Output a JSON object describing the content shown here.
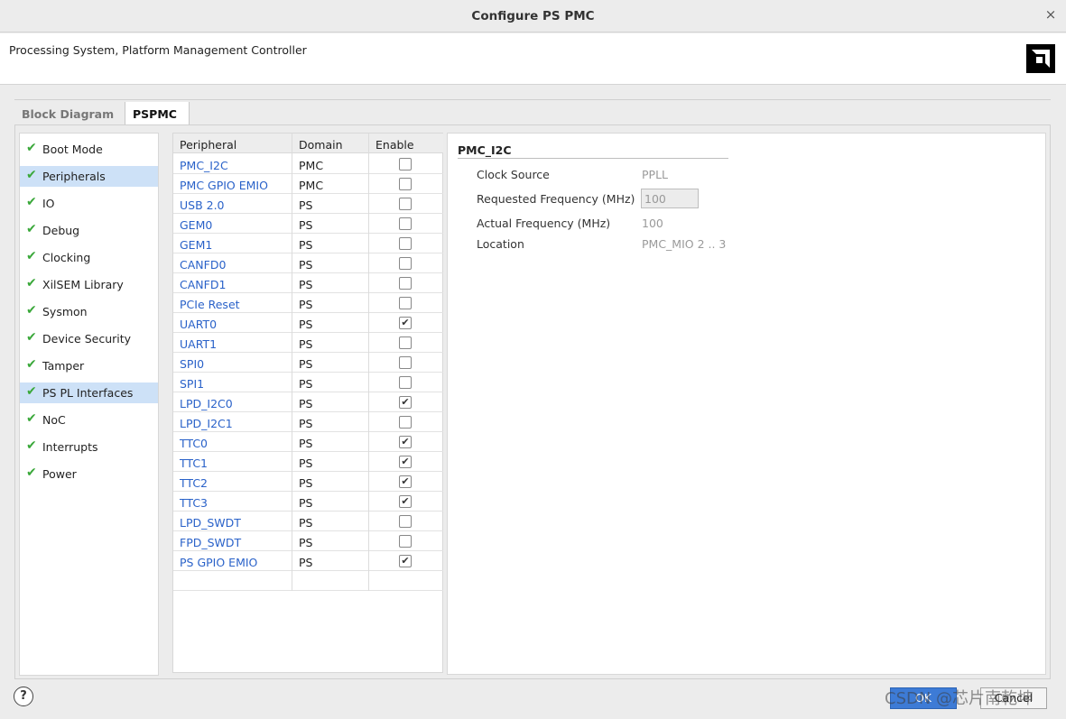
{
  "window": {
    "title": "Configure PS PMC",
    "close_glyph": "×"
  },
  "header": {
    "subtitle": "Processing System, Platform Management Controller",
    "logo": "amd-logo-icon"
  },
  "tabs": [
    {
      "label": "Block Diagram",
      "accesskey": "B",
      "selected": false
    },
    {
      "label": "PSPMC",
      "accesskey": "P",
      "selected": true
    }
  ],
  "sidebar": {
    "items": [
      {
        "label": "Boot Mode",
        "selected": false
      },
      {
        "label": "Peripherals",
        "selected": true
      },
      {
        "label": "IO",
        "selected": false
      },
      {
        "label": "Debug",
        "selected": false
      },
      {
        "label": "Clocking",
        "selected": false
      },
      {
        "label": "XilSEM Library",
        "selected": false
      },
      {
        "label": "Sysmon",
        "selected": false
      },
      {
        "label": "Device Security",
        "selected": false
      },
      {
        "label": "Tamper",
        "selected": false
      },
      {
        "label": "PS PL Interfaces",
        "selected": true
      },
      {
        "label": "NoC",
        "selected": false
      },
      {
        "label": "Interrupts",
        "selected": false
      },
      {
        "label": "Power",
        "selected": false
      }
    ],
    "check_glyph": "✔"
  },
  "table": {
    "columns": [
      "Peripheral",
      "Domain",
      "Enable"
    ],
    "rows": [
      {
        "peripheral": "PMC_I2C",
        "domain": "PMC",
        "enabled": false
      },
      {
        "peripheral": "PMC GPIO EMIO",
        "domain": "PMC",
        "enabled": false
      },
      {
        "peripheral": "USB 2.0",
        "domain": "PS",
        "enabled": false
      },
      {
        "peripheral": "GEM0",
        "domain": "PS",
        "enabled": false
      },
      {
        "peripheral": "GEM1",
        "domain": "PS",
        "enabled": false
      },
      {
        "peripheral": "CANFD0",
        "domain": "PS",
        "enabled": false
      },
      {
        "peripheral": "CANFD1",
        "domain": "PS",
        "enabled": false
      },
      {
        "peripheral": "PCIe Reset",
        "domain": "PS",
        "enabled": false
      },
      {
        "peripheral": "UART0",
        "domain": "PS",
        "enabled": true
      },
      {
        "peripheral": "UART1",
        "domain": "PS",
        "enabled": false
      },
      {
        "peripheral": "SPI0",
        "domain": "PS",
        "enabled": false
      },
      {
        "peripheral": "SPI1",
        "domain": "PS",
        "enabled": false
      },
      {
        "peripheral": "LPD_I2C0",
        "domain": "PS",
        "enabled": true
      },
      {
        "peripheral": "LPD_I2C1",
        "domain": "PS",
        "enabled": false
      },
      {
        "peripheral": "TTC0",
        "domain": "PS",
        "enabled": true
      },
      {
        "peripheral": "TTC1",
        "domain": "PS",
        "enabled": true
      },
      {
        "peripheral": "TTC2",
        "domain": "PS",
        "enabled": true
      },
      {
        "peripheral": "TTC3",
        "domain": "PS",
        "enabled": true
      },
      {
        "peripheral": "LPD_SWDT",
        "domain": "PS",
        "enabled": false
      },
      {
        "peripheral": "FPD_SWDT",
        "domain": "PS",
        "enabled": false
      },
      {
        "peripheral": "PS GPIO EMIO",
        "domain": "PS",
        "enabled": true
      }
    ]
  },
  "detail": {
    "title": "PMC_I2C",
    "clock_source_label": "Clock Source",
    "clock_source_value": "PPLL",
    "requested_freq_label": "Requested Frequency (MHz)",
    "requested_freq_value": "100",
    "actual_freq_label": "Actual Frequency (MHz)",
    "actual_freq_value": "100",
    "location_label": "Location",
    "location_value": "PMC_MIO 2 .. 3"
  },
  "footer": {
    "help_glyph": "?",
    "ok_label": "OK",
    "cancel_label": "Cancel",
    "watermark": "CSDN @芯片南乾坤"
  }
}
